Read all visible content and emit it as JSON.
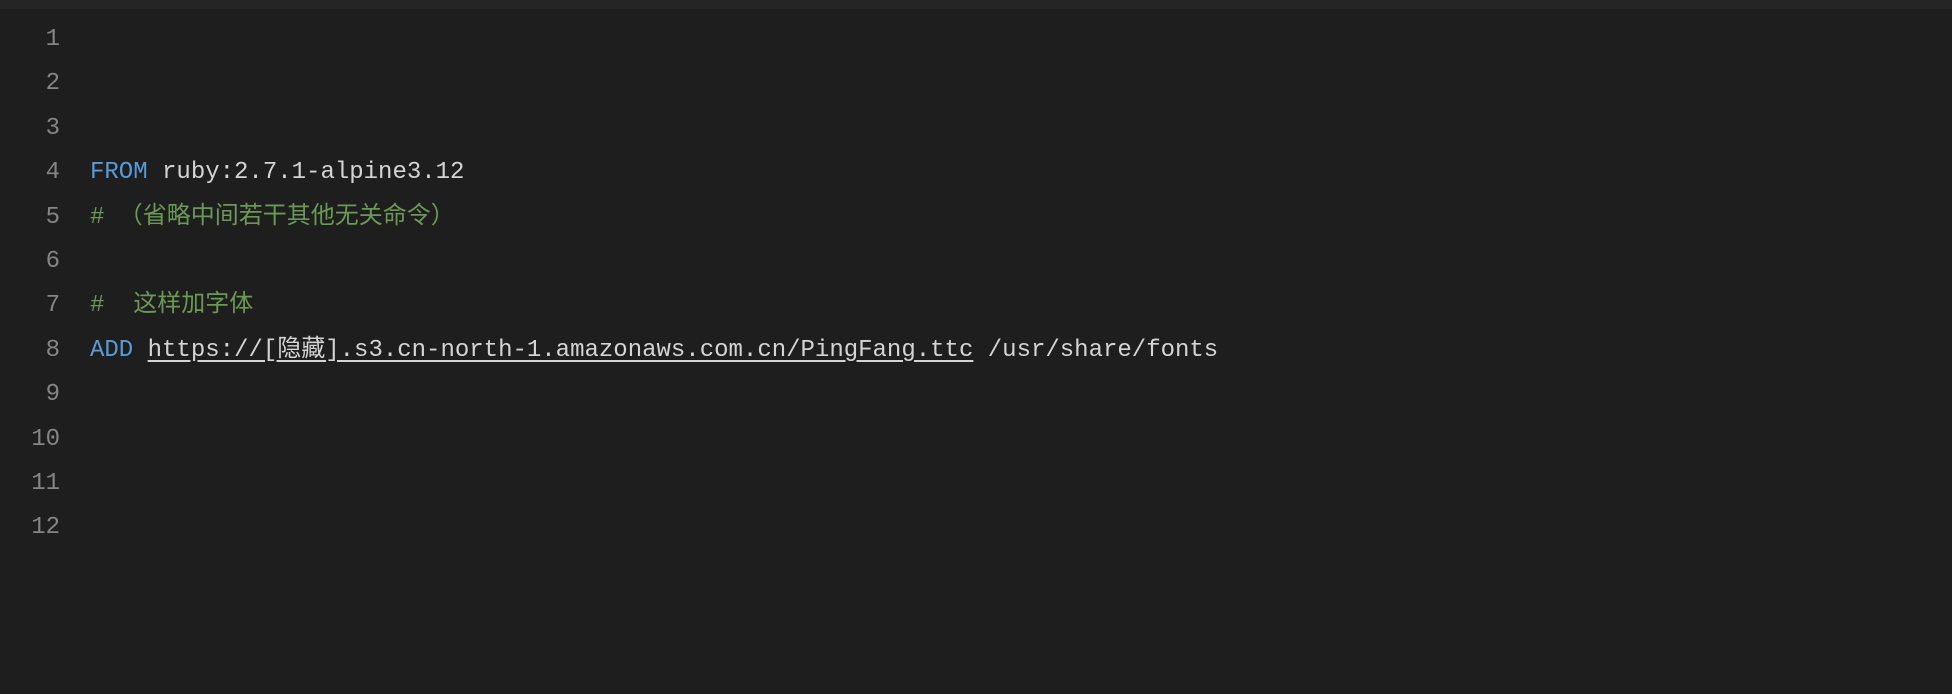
{
  "editor": {
    "lines": [
      {
        "num": "1",
        "tokens": []
      },
      {
        "num": "2",
        "tokens": []
      },
      {
        "num": "3",
        "tokens": []
      },
      {
        "num": "4",
        "tokens": [
          {
            "t": "FROM",
            "cls": "tok-keyword"
          },
          {
            "t": " ruby:2.7.1-alpine3.12",
            "cls": "tok-text"
          }
        ]
      },
      {
        "num": "5",
        "tokens": [
          {
            "t": "# （省略中间若干其他无关命令）",
            "cls": "tok-comment"
          }
        ]
      },
      {
        "num": "6",
        "tokens": []
      },
      {
        "num": "7",
        "tokens": [
          {
            "t": "#  这样加字体",
            "cls": "tok-comment"
          }
        ]
      },
      {
        "num": "8",
        "tokens": [
          {
            "t": "ADD",
            "cls": "tok-keyword"
          },
          {
            "t": " ",
            "cls": "tok-text"
          },
          {
            "t": "https://[隐藏].s3.cn-north-1.amazonaws.com.cn/PingFang.ttc",
            "cls": "tok-url"
          },
          {
            "t": " /usr/share/fonts",
            "cls": "tok-text"
          }
        ]
      },
      {
        "num": "9",
        "tokens": []
      },
      {
        "num": "10",
        "tokens": []
      },
      {
        "num": "11",
        "tokens": []
      },
      {
        "num": "12",
        "tokens": []
      }
    ]
  }
}
